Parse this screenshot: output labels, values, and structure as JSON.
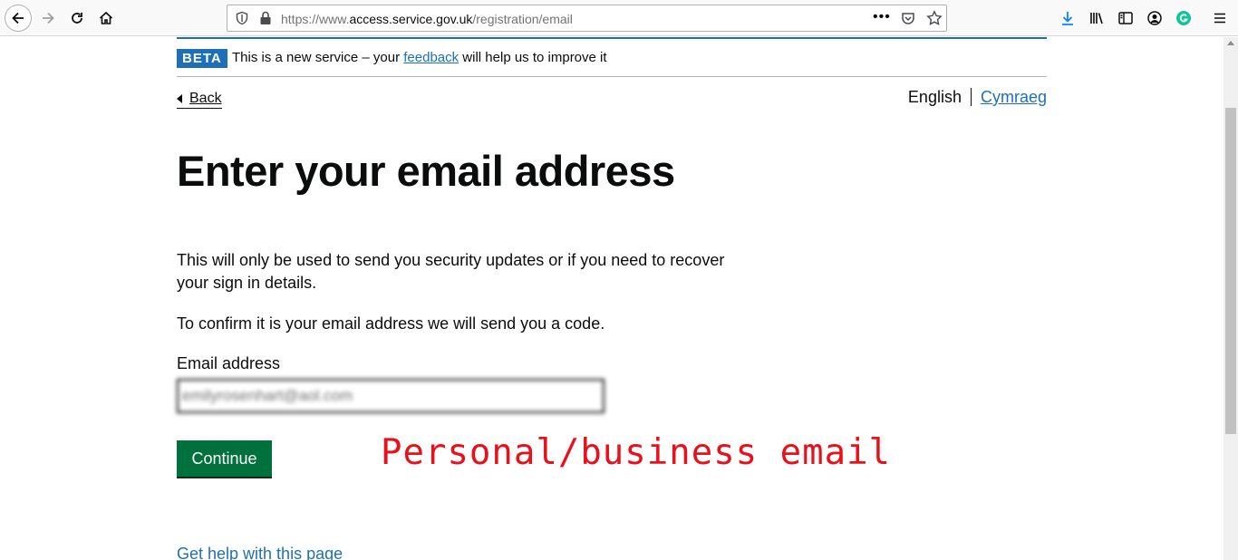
{
  "browser": {
    "url_prefix": "https://www.",
    "url_host": "access.service.gov.uk",
    "url_path": "/registration/email",
    "more_label": "•••"
  },
  "page": {
    "phase_banner": {
      "tag": "BETA",
      "text_before": "This is a new service – your ",
      "link": "feedback",
      "text_after": " will help us to improve it"
    },
    "back_link": "Back",
    "language": {
      "current": "English",
      "other": "Cymraeg"
    },
    "heading": "Enter your email address",
    "paragraph_1": "This will only be used to send you security updates or if you need to recover your sign in details.",
    "paragraph_2": "To confirm it is your email address we will send you a code.",
    "email_label": "Email address",
    "email_value": "emilyrosenhart@aol.com",
    "continue_label": "Continue",
    "help_link": "Get help with this page"
  },
  "annotation": {
    "text": "Personal/business email",
    "color": "#e8111b"
  },
  "colors": {
    "link_blue": "#1d70b8",
    "button_green": "#00703c",
    "text_black": "#0b0c0c"
  }
}
